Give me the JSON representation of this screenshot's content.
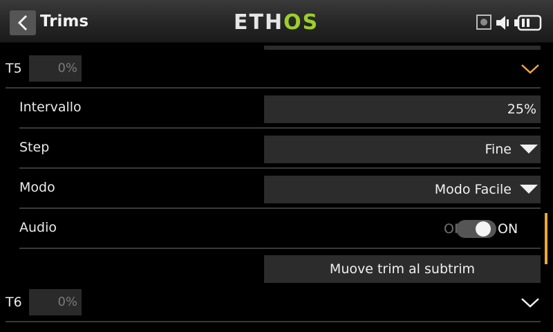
{
  "header": {
    "title": "Trims",
    "logo_part1": "ETH",
    "logo_part2": "OS",
    "icons": [
      "back-arrow-icon",
      "sd-card-icon",
      "speaker-icon",
      "battery-icon"
    ]
  },
  "trim5": {
    "name": "T5",
    "value": "0%",
    "expanded": true,
    "fields": {
      "interval_label": "Intervallo",
      "interval_value": "25%",
      "step_label": "Step",
      "step_value": "Fine",
      "mode_label": "Modo",
      "mode_value": "Modo Facile",
      "audio_label": "Audio",
      "audio_off": "OFF",
      "audio_on": "ON",
      "audio_state": true,
      "action_label": "Muove trim al subtrim"
    }
  },
  "trim6": {
    "name": "T6",
    "value": "0%",
    "expanded": false
  },
  "colors": {
    "accent": "#f0a63a",
    "logo_green": "#9ccf2a",
    "field_bg": "#2c2c2c"
  }
}
